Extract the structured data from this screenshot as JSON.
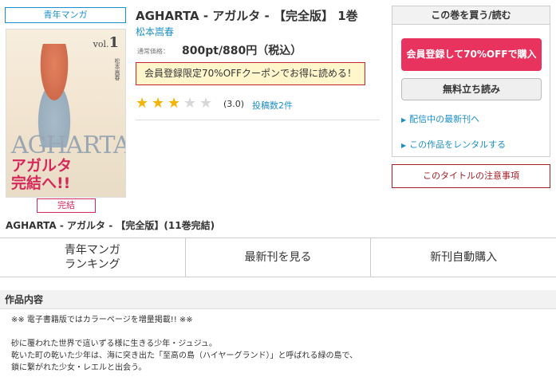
{
  "genre_tag": "青年マンガ",
  "cover": {
    "vol_prefix": "vol.",
    "vol_num": "1",
    "title_text": "AGHARTA",
    "catch_line1": "アガルタ",
    "catch_line2": "完結へ!!",
    "side_text": "松本嵩春"
  },
  "complete_badge": "完結",
  "book": {
    "title": "AGHARTA - アガルタ - 【完全版】 1巻",
    "author": "松本嵩春",
    "price_label": "通常価格：",
    "price": "800pt/880円（税込）",
    "coupon": "会員登録限定70%OFFクーポンでお得に読める！",
    "rating_value": 3.0,
    "rating_text": "(3.0)",
    "reviews": "投稿数2件"
  },
  "buy_box": {
    "heading": "この巻を買う/読む",
    "buy_button": "会員登録して70%OFFで購入",
    "free_button": "無料立ち読み",
    "link_latest": "配信中の最新刊へ",
    "link_rental": "この作品をレンタルする"
  },
  "notice_button": "このタイトルの注意事項",
  "series_title": "AGHARTA - アガルタ - 【完全版】(11巻完結)",
  "nav": {
    "ranking_line1": "青年マンガ",
    "ranking_line2": "ランキング",
    "latest": "最新刊を見る",
    "auto_buy": "新刊自動購入"
  },
  "description": {
    "heading": "作品内容",
    "line1": "※※ 電子書籍版ではカラーページを増量掲載!! ※※",
    "line2": "砂に覆われた世界で這いずる様に生きる少年・ジュジュ。",
    "line3": "乾いた町の乾いた少年は、海に突き出た「至高の島（ハイヤーグランド）」と呼ばれる緑の島で、",
    "line4": "鎖に繋がれた少女・レエルと出会う。"
  },
  "colors": {
    "accent_blue": "#1b8fc9",
    "buy_pink": "#e8335e",
    "notice_red": "#a32028",
    "star_gold": "#f4b400"
  }
}
